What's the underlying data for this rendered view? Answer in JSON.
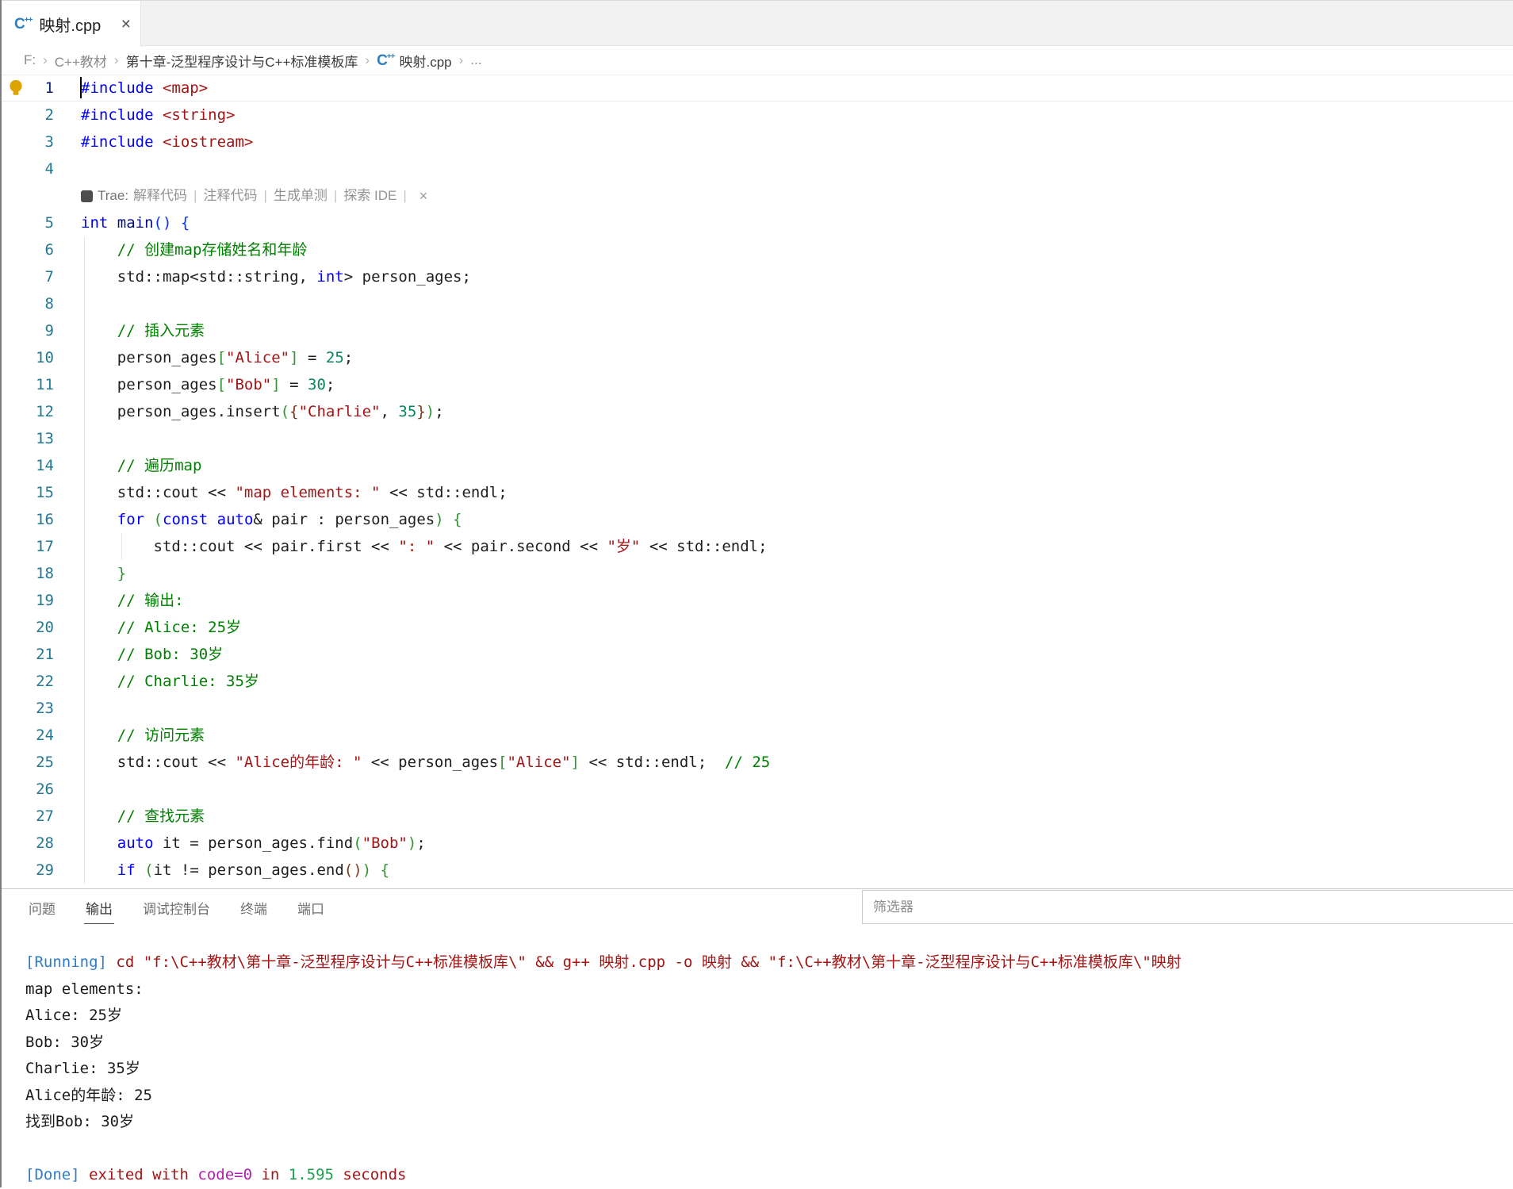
{
  "tab": {
    "title": "映射.cpp",
    "close": "×"
  },
  "breadcrumb": {
    "chevron": "›",
    "items": [
      {
        "label": "F:",
        "emph": false,
        "icon": false
      },
      {
        "label": "C++教材",
        "emph": false,
        "icon": false
      },
      {
        "label": "第十章-泛型程序设计与C++标准模板库",
        "emph": true,
        "icon": false
      },
      {
        "label": "映射.cpp",
        "emph": true,
        "icon": true
      },
      {
        "label": "...",
        "emph": false,
        "icon": false
      }
    ]
  },
  "editor": {
    "hint": {
      "label": "Trae:",
      "actions": [
        "解释代码",
        "注释代码",
        "生成单测",
        "探索 IDE"
      ],
      "separator": "|",
      "close": "×"
    },
    "lines": [
      {
        "n": 1,
        "t": [
          [
            "#include",
            "k"
          ],
          [
            " ",
            "p"
          ],
          [
            "<map>",
            "s"
          ]
        ]
      },
      {
        "n": 2,
        "t": [
          [
            "#include",
            "k"
          ],
          [
            " ",
            "p"
          ],
          [
            "<string>",
            "s"
          ]
        ]
      },
      {
        "n": 3,
        "t": [
          [
            "#include",
            "k"
          ],
          [
            " ",
            "p"
          ],
          [
            "<iostream>",
            "s"
          ]
        ]
      },
      {
        "n": 4,
        "t": []
      },
      {
        "hint": true
      },
      {
        "n": 5,
        "t": [
          [
            "int",
            "k"
          ],
          [
            " ",
            "p"
          ],
          [
            "main",
            "f"
          ],
          [
            "(",
            "b1"
          ],
          [
            ")",
            "b1"
          ],
          [
            " ",
            "p"
          ],
          [
            "{",
            "b1"
          ]
        ]
      },
      {
        "n": 6,
        "t": [
          [
            "    ",
            "p"
          ],
          [
            "// 创建map存储姓名和年龄",
            "c"
          ]
        ]
      },
      {
        "n": 7,
        "t": [
          [
            "    std::map<std::string, ",
            "p"
          ],
          [
            "int",
            "k"
          ],
          [
            "> person_ages;",
            "p"
          ]
        ]
      },
      {
        "n": 8,
        "t": []
      },
      {
        "n": 9,
        "t": [
          [
            "    ",
            "p"
          ],
          [
            "// 插入元素",
            "c"
          ]
        ]
      },
      {
        "n": 10,
        "t": [
          [
            "    person_ages",
            "p"
          ],
          [
            "[",
            "b2"
          ],
          [
            "\"Alice\"",
            "s"
          ],
          [
            "]",
            "b2"
          ],
          [
            " = ",
            "p"
          ],
          [
            "25",
            "n"
          ],
          [
            ";",
            "p"
          ]
        ]
      },
      {
        "n": 11,
        "t": [
          [
            "    person_ages",
            "p"
          ],
          [
            "[",
            "b2"
          ],
          [
            "\"Bob\"",
            "s"
          ],
          [
            "]",
            "b2"
          ],
          [
            " = ",
            "p"
          ],
          [
            "30",
            "n"
          ],
          [
            ";",
            "p"
          ]
        ]
      },
      {
        "n": 12,
        "t": [
          [
            "    person_ages.insert",
            "p"
          ],
          [
            "(",
            "b2"
          ],
          [
            "{",
            "b3"
          ],
          [
            "\"Charlie\"",
            "s"
          ],
          [
            ", ",
            "p"
          ],
          [
            "35",
            "n"
          ],
          [
            "}",
            "b3"
          ],
          [
            ")",
            "b2"
          ],
          [
            ";",
            "p"
          ]
        ]
      },
      {
        "n": 13,
        "t": []
      },
      {
        "n": 14,
        "t": [
          [
            "    ",
            "p"
          ],
          [
            "// 遍历map",
            "c"
          ]
        ]
      },
      {
        "n": 15,
        "t": [
          [
            "    std::cout << ",
            "p"
          ],
          [
            "\"map elements: \"",
            "s"
          ],
          [
            " << std::endl;",
            "p"
          ]
        ]
      },
      {
        "n": 16,
        "t": [
          [
            "    ",
            "p"
          ],
          [
            "for",
            "k"
          ],
          [
            " ",
            "p"
          ],
          [
            "(",
            "b2"
          ],
          [
            "const",
            "k"
          ],
          [
            " ",
            "p"
          ],
          [
            "auto",
            "k"
          ],
          [
            "& pair : person_ages",
            "p"
          ],
          [
            ")",
            "b2"
          ],
          [
            " ",
            "p"
          ],
          [
            "{",
            "b2"
          ]
        ]
      },
      {
        "n": 17,
        "t": [
          [
            "        std::cout << pair.first << ",
            "p"
          ],
          [
            "\": \"",
            "s"
          ],
          [
            " << pair.second << ",
            "p"
          ],
          [
            "\"岁\"",
            "s"
          ],
          [
            " << std::endl;",
            "p"
          ]
        ]
      },
      {
        "n": 18,
        "t": [
          [
            "    ",
            "p"
          ],
          [
            "}",
            "b2"
          ]
        ]
      },
      {
        "n": 19,
        "t": [
          [
            "    ",
            "p"
          ],
          [
            "// 输出:",
            "c"
          ]
        ]
      },
      {
        "n": 20,
        "t": [
          [
            "    ",
            "p"
          ],
          [
            "// Alice: 25岁",
            "c"
          ]
        ]
      },
      {
        "n": 21,
        "t": [
          [
            "    ",
            "p"
          ],
          [
            "// Bob: 30岁",
            "c"
          ]
        ]
      },
      {
        "n": 22,
        "t": [
          [
            "    ",
            "p"
          ],
          [
            "// Charlie: 35岁",
            "c"
          ]
        ]
      },
      {
        "n": 23,
        "t": []
      },
      {
        "n": 24,
        "t": [
          [
            "    ",
            "p"
          ],
          [
            "// 访问元素",
            "c"
          ]
        ]
      },
      {
        "n": 25,
        "t": [
          [
            "    std::cout << ",
            "p"
          ],
          [
            "\"Alice的年龄: \"",
            "s"
          ],
          [
            " << person_ages",
            "p"
          ],
          [
            "[",
            "b2"
          ],
          [
            "\"Alice\"",
            "s"
          ],
          [
            "]",
            "b2"
          ],
          [
            " << std::endl;  ",
            "p"
          ],
          [
            "// 25",
            "c"
          ]
        ]
      },
      {
        "n": 26,
        "t": []
      },
      {
        "n": 27,
        "t": [
          [
            "    ",
            "p"
          ],
          [
            "// 查找元素",
            "c"
          ]
        ]
      },
      {
        "n": 28,
        "t": [
          [
            "    ",
            "p"
          ],
          [
            "auto",
            "k"
          ],
          [
            " it = person_ages.find",
            "p"
          ],
          [
            "(",
            "b2"
          ],
          [
            "\"Bob\"",
            "s"
          ],
          [
            ")",
            "b2"
          ],
          [
            ";",
            "p"
          ]
        ]
      },
      {
        "n": 29,
        "t": [
          [
            "    ",
            "p"
          ],
          [
            "if",
            "k"
          ],
          [
            " ",
            "p"
          ],
          [
            "(",
            "b2"
          ],
          [
            "it != person_ages.end",
            "p"
          ],
          [
            "(",
            "b3"
          ],
          [
            ")",
            "b3"
          ],
          [
            ")",
            "b2"
          ],
          [
            " ",
            "p"
          ],
          [
            "{",
            "b2"
          ]
        ]
      }
    ]
  },
  "panel": {
    "tabs": [
      {
        "key": "problems",
        "label": "问题",
        "active": false
      },
      {
        "key": "output",
        "label": "输出",
        "active": true
      },
      {
        "key": "debug-console",
        "label": "调试控制台",
        "active": false
      },
      {
        "key": "terminal",
        "label": "终端",
        "active": false
      },
      {
        "key": "ports",
        "label": "端口",
        "active": false
      }
    ],
    "filter_placeholder": "筛选器",
    "output": [
      {
        "s": [
          [
            "[Running]",
            "o-lbl"
          ],
          [
            " cd \"f:\\C++教材\\第十章-泛型程序设计与C++标准模板库\\\" && g++ 映射.cpp -o 映射 && \"f:\\C++教材\\第十章-泛型程序设计与C++标准模板库\\\"映射",
            "o-cmd"
          ]
        ]
      },
      {
        "s": [
          [
            "map elements:",
            "o-txt"
          ]
        ]
      },
      {
        "s": [
          [
            "Alice: 25岁",
            "o-txt"
          ]
        ]
      },
      {
        "s": [
          [
            "Bob: 30岁",
            "o-txt"
          ]
        ]
      },
      {
        "s": [
          [
            "Charlie: 35岁",
            "o-txt"
          ]
        ]
      },
      {
        "s": [
          [
            "Alice的年龄: 25",
            "o-txt"
          ]
        ]
      },
      {
        "s": [
          [
            "找到Bob: 30岁",
            "o-txt"
          ]
        ]
      },
      {
        "s": []
      },
      {
        "s": [
          [
            "[Done]",
            "o-lbl"
          ],
          [
            " ",
            "o-cmd"
          ],
          [
            "exited with ",
            "o-cmd"
          ],
          [
            "code=0",
            "o-code"
          ],
          [
            " in ",
            "o-cmd"
          ],
          [
            "1.595",
            "o-num"
          ],
          [
            " seconds",
            "o-cmd"
          ]
        ]
      }
    ]
  },
  "colors": {
    "keyword": "#0000ff",
    "string": "#a31515",
    "comment": "#008000",
    "number": "#098658",
    "line_number": "#237893",
    "running_label": "#2e7cc9",
    "command_text": "#a31515"
  }
}
